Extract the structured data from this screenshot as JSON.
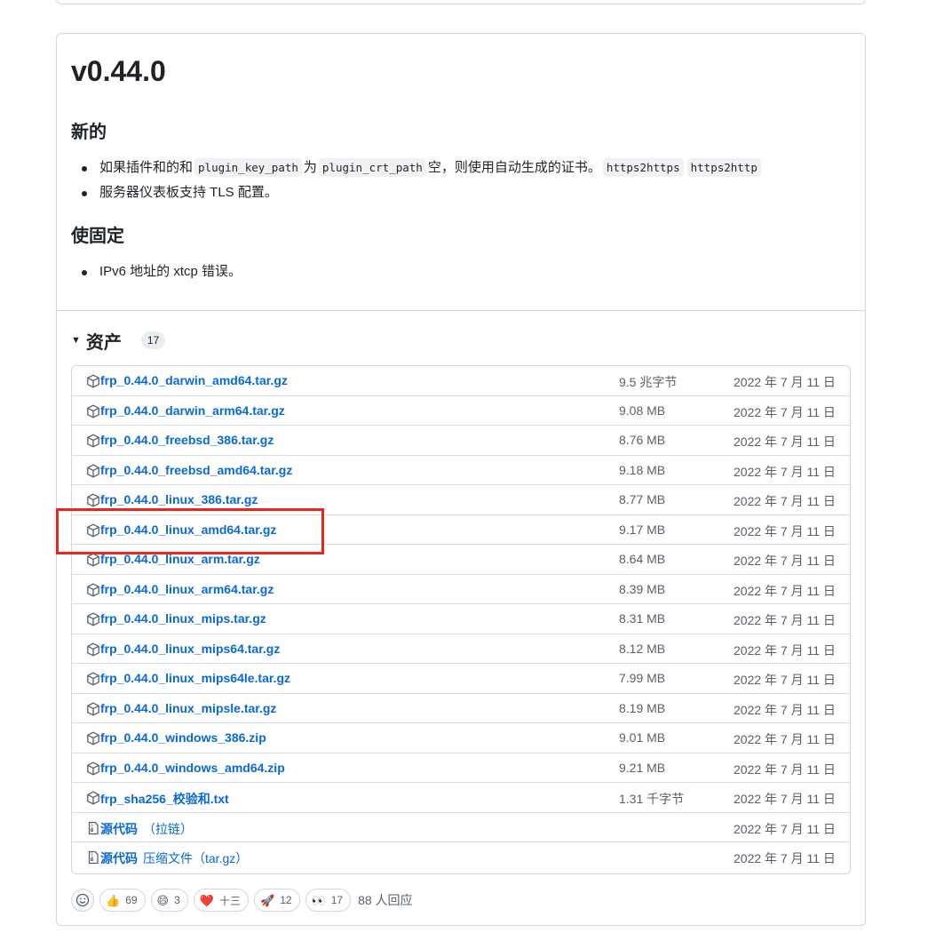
{
  "release": {
    "version": "v0.44.0",
    "new_heading": "新的",
    "new_items": [
      {
        "text_before": "如果插件和的和",
        "code1": "plugin_key_path",
        "text_mid": "为",
        "code2": "plugin_crt_path",
        "text_after": "空，则使用自动生成的证书。",
        "code3": "https2https",
        "code4": "https2http"
      },
      {
        "text": "服务器仪表板支持 TLS 配置。"
      }
    ],
    "fix_heading": "使固定",
    "fix_items": [
      {
        "text": "IPv6 地址的 xtcp 错误。"
      }
    ]
  },
  "assets": {
    "title": "资产",
    "count": "17",
    "rows": [
      {
        "name": "frp_0.44.0_darwin_amd64.tar.gz",
        "size": "9.5 兆字节",
        "date": "2022 年 7 月 11 日",
        "icon": "package-icon"
      },
      {
        "name": "frp_0.44.0_darwin_arm64.tar.gz",
        "size": "9.08 MB",
        "date": "2022 年 7 月 11 日",
        "icon": "package-icon"
      },
      {
        "name": "frp_0.44.0_freebsd_386.tar.gz",
        "size": "8.76 MB",
        "date": "2022 年 7 月 11 日",
        "icon": "package-icon"
      },
      {
        "name": "frp_0.44.0_freebsd_amd64.tar.gz",
        "size": "9.18 MB",
        "date": "2022 年 7 月 11 日",
        "icon": "package-icon"
      },
      {
        "name": "frp_0.44.0_linux_386.tar.gz",
        "size": "8.77 MB",
        "date": "2022 年 7 月 11 日",
        "icon": "package-icon"
      },
      {
        "name": "frp_0.44.0_linux_amd64.tar.gz",
        "size": "9.17 MB",
        "date": "2022 年 7 月 11 日",
        "icon": "package-icon"
      },
      {
        "name": "frp_0.44.0_linux_arm.tar.gz",
        "size": "8.64 MB",
        "date": "2022 年 7 月 11 日",
        "icon": "package-icon"
      },
      {
        "name": "frp_0.44.0_linux_arm64.tar.gz",
        "size": "8.39 MB",
        "date": "2022 年 7 月 11 日",
        "icon": "package-icon"
      },
      {
        "name": "frp_0.44.0_linux_mips.tar.gz",
        "size": "8.31 MB",
        "date": "2022 年 7 月 11 日",
        "icon": "package-icon"
      },
      {
        "name": "frp_0.44.0_linux_mips64.tar.gz",
        "size": "8.12 MB",
        "date": "2022 年 7 月 11 日",
        "icon": "package-icon"
      },
      {
        "name": "frp_0.44.0_linux_mips64le.tar.gz",
        "size": "7.99 MB",
        "date": "2022 年 7 月 11 日",
        "icon": "package-icon"
      },
      {
        "name": "frp_0.44.0_linux_mipsle.tar.gz",
        "size": "8.19 MB",
        "date": "2022 年 7 月 11 日",
        "icon": "package-icon"
      },
      {
        "name": "frp_0.44.0_windows_386.zip",
        "size": "9.01 MB",
        "date": "2022 年 7 月 11 日",
        "icon": "package-icon"
      },
      {
        "name": "frp_0.44.0_windows_amd64.zip",
        "size": "9.21 MB",
        "date": "2022 年 7 月 11 日",
        "icon": "package-icon"
      },
      {
        "name": "frp_sha256_校验和.txt",
        "size": "1.31 千字节",
        "date": "2022 年 7 月 11 日",
        "icon": "package-icon"
      },
      {
        "name": "源代码",
        "extra": "（拉链）",
        "size": "",
        "date": "2022 年 7 月 11 日",
        "icon": "file-zip-icon"
      },
      {
        "name": "源代码",
        "extra": "压缩文件（tar.gz）",
        "size": "",
        "date": "2022 年 7 月 11 日",
        "icon": "file-zip-icon"
      }
    ]
  },
  "reactions": {
    "items": [
      {
        "emoji": "👍",
        "name": "thumbs-up-reaction",
        "count": "69"
      },
      {
        "emoji": "😄",
        "name": "laugh-reaction",
        "count": "3"
      },
      {
        "emoji": "❤️",
        "name": "heart-reaction",
        "count": "十三"
      },
      {
        "emoji": "🚀",
        "name": "rocket-reaction",
        "count": "12"
      },
      {
        "emoji": "👀",
        "name": "eyes-reaction",
        "count": "17"
      }
    ],
    "summary": "88 人回应"
  },
  "colors": {
    "link": "#0969da",
    "annotation": "#e8261c",
    "border": "#d0d7de"
  }
}
